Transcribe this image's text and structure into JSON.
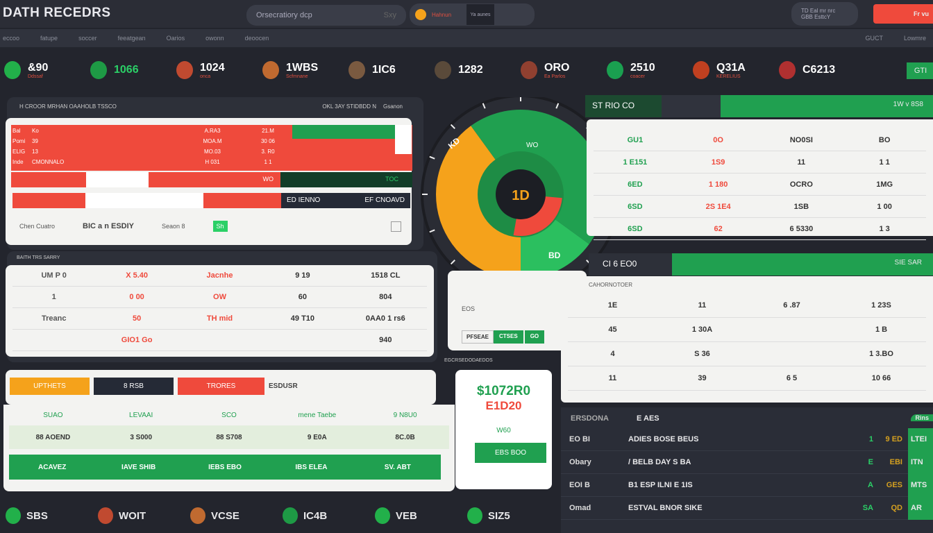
{
  "header": {
    "title": "DATH RECEDRS",
    "search_placeholder": "Orsecratiory dcp",
    "search_hint": "Sxy",
    "stream_label": "Hahnun",
    "stream_sub": "Ya aunes",
    "user_line1": "TD  Eal mr nrc",
    "user_line2": "GBB  EsttcY",
    "cta_label": "Fr vu"
  },
  "subnav": {
    "items": [
      "eccoo",
      "fatupe",
      "soccer",
      "feeatgean",
      "Oarios",
      "owonn",
      "deoocen"
    ],
    "right_items": [
      "GUCT",
      "Lowmre"
    ]
  },
  "players": [
    {
      "value": "&90",
      "sub": "Ddssaf",
      "color": "#ffffff",
      "face": "#22b04a"
    },
    {
      "value": "1066",
      "sub": "",
      "color": "#2bd067",
      "face": "#1e9a45"
    },
    {
      "value": "1024",
      "sub": "onca",
      "color": "#ffffff",
      "face": "#c04a30"
    },
    {
      "value": "1WBS",
      "sub": "Scfmnane",
      "color": "#ffffff",
      "face": "#c06a30"
    },
    {
      "value": "1IC6",
      "sub": "",
      "color": "#ffffff",
      "face": "#7a5a40"
    },
    {
      "value": "1282",
      "sub": "",
      "color": "#ffffff",
      "face": "#5a4a3a"
    },
    {
      "value": "ORO",
      "sub": "Ea Parlos",
      "color": "#ffffff",
      "face": "#904030"
    },
    {
      "value": "2510",
      "sub": "coacer",
      "color": "#ffffff",
      "face": "#1aa050"
    },
    {
      "value": "Q31A",
      "sub": "KERELIUS",
      "color": "#ffffff",
      "face": "#c04020"
    },
    {
      "value": "C6213",
      "sub": "",
      "color": "#ffffff",
      "face": "#b03030"
    }
  ],
  "strip_button": "GTI",
  "panel1": {
    "title": "H CROOR MRHAN OAAHOLB TSSCO",
    "meta": "OKL 3AY  STIDBDD N",
    "meta2": "Gsanon",
    "rows": [
      [
        "Bal",
        "Ko",
        "A.RA3",
        "21.M"
      ],
      [
        "Pomi",
        "39",
        "MOA.M",
        "30 06"
      ],
      [
        "ELIG",
        "13",
        "MO.03",
        "3. R0"
      ],
      [
        "Inde",
        "CMONNALO",
        "H 031",
        "1 1"
      ]
    ],
    "bar2_value": "WO",
    "bar2_right": "TOC",
    "bar3_left": "ED IENNO",
    "bar3_right": "EF CNOAVD",
    "footer": [
      "Chen Cuatro",
      "BIC a n ESDIY",
      "Seaon 8",
      "Sh"
    ]
  },
  "gauge": {
    "center_label": "1D",
    "slice1": "KD",
    "slice2": "WO",
    "slice3": "BD"
  },
  "gauge_data": {
    "type": "pie",
    "values": [
      45,
      15,
      40
    ],
    "colors": [
      "#20a050",
      "#f5a21b",
      "#ef4a3c"
    ]
  },
  "gauge_card": {
    "label": "EOS",
    "btn1": "PFSEAE",
    "btn2": "CTSES",
    "btn3": "GO"
  },
  "panel2": {
    "title": "BAITH TRS SARRY",
    "rows": [
      [
        "UM P 0",
        "X 5.40",
        "Jacnhe",
        "9 19",
        "1518 CL"
      ],
      [
        "1",
        "0 00",
        "OW",
        "60",
        "804"
      ],
      [
        "Treanc",
        "50",
        "TH mid",
        "49 T10",
        "0AA0 1 rs6"
      ],
      [
        "",
        "GIO1 Go",
        "",
        "",
        "940"
      ]
    ]
  },
  "panel3": {
    "header": "ST RIO CO",
    "green_label": "1W v 8S8",
    "rows": [
      [
        "GU1",
        "0O",
        "NO0SI",
        "BO"
      ],
      [
        "1 E151",
        "1S9",
        "11",
        "1 1"
      ],
      [
        "6ED",
        "1 180",
        "OCRO",
        "1MG"
      ],
      [
        "6SD",
        "2S 1E4",
        "1SB",
        "1 00"
      ],
      [
        "6SD",
        "62",
        "6 5330",
        "1 3"
      ]
    ]
  },
  "panel4": {
    "header": "CI 6 EO0",
    "green_label": "SIE SAR",
    "sub": "CAHORNOTOER",
    "rows": [
      [
        "1E",
        "11",
        "6 .87",
        "1 23S"
      ],
      [
        "45",
        "1 30A",
        "",
        "1 B"
      ],
      [
        "4",
        "S 36",
        "",
        "1 3.BO"
      ],
      [
        "11",
        "39",
        "6 5",
        "10 66"
      ]
    ]
  },
  "section_label": "EGCRSEDODAEDOS",
  "tabs": [
    {
      "label": "UPTHETS",
      "color": "#f5a21b"
    },
    {
      "label": "8  RSB",
      "color": "#252a36"
    },
    {
      "label": "TRORES",
      "color": "#ef4a3c"
    }
  ],
  "tab_side": "ESDUSR",
  "table5": {
    "header": [
      "SUAO",
      "LEVAAI",
      "SCO",
      "mene Taebe",
      "9 N8U0"
    ],
    "row": [
      "88 AOEND",
      "3 S000",
      "88 S708",
      "9 E0A",
      "8C.0B"
    ],
    "green_row": [
      "ACAVEZ",
      "IAVE SHIB",
      "IEBS EBO",
      "IBS ELEA",
      "SV. ABT"
    ]
  },
  "promo": {
    "value": "$1072R0",
    "sub": "E1D20",
    "label": "W60",
    "button": "EBS BOO"
  },
  "dark_table": {
    "header": [
      "ERSDONA",
      "E AES"
    ],
    "side_header": "Rins",
    "rows": [
      [
        "EO BI",
        "ADIES BOSE BEUS",
        "1",
        "9 ED",
        "LTEI"
      ],
      [
        "Obary",
        "/ BELB DAY S BA",
        "E",
        "EBI",
        "ITN"
      ],
      [
        "EOI B",
        "B1 ESP ILNI E 1IS",
        "A",
        "GES",
        "MTS"
      ],
      [
        "Omad",
        "ESTVAL BNOR SIKE",
        "SA",
        "QD",
        "AR"
      ]
    ]
  },
  "bottom_players": [
    {
      "value": "SBS",
      "color": "#22b04a"
    },
    {
      "value": "WOIT",
      "color": "#c04a30"
    },
    {
      "value": "VCSE",
      "color": "#c06a30"
    },
    {
      "value": "IC4B",
      "color": "#1e9a45"
    },
    {
      "value": "VEB",
      "color": "#22b04a"
    },
    {
      "value": "SIZ5",
      "color": "#22b04a"
    }
  ]
}
